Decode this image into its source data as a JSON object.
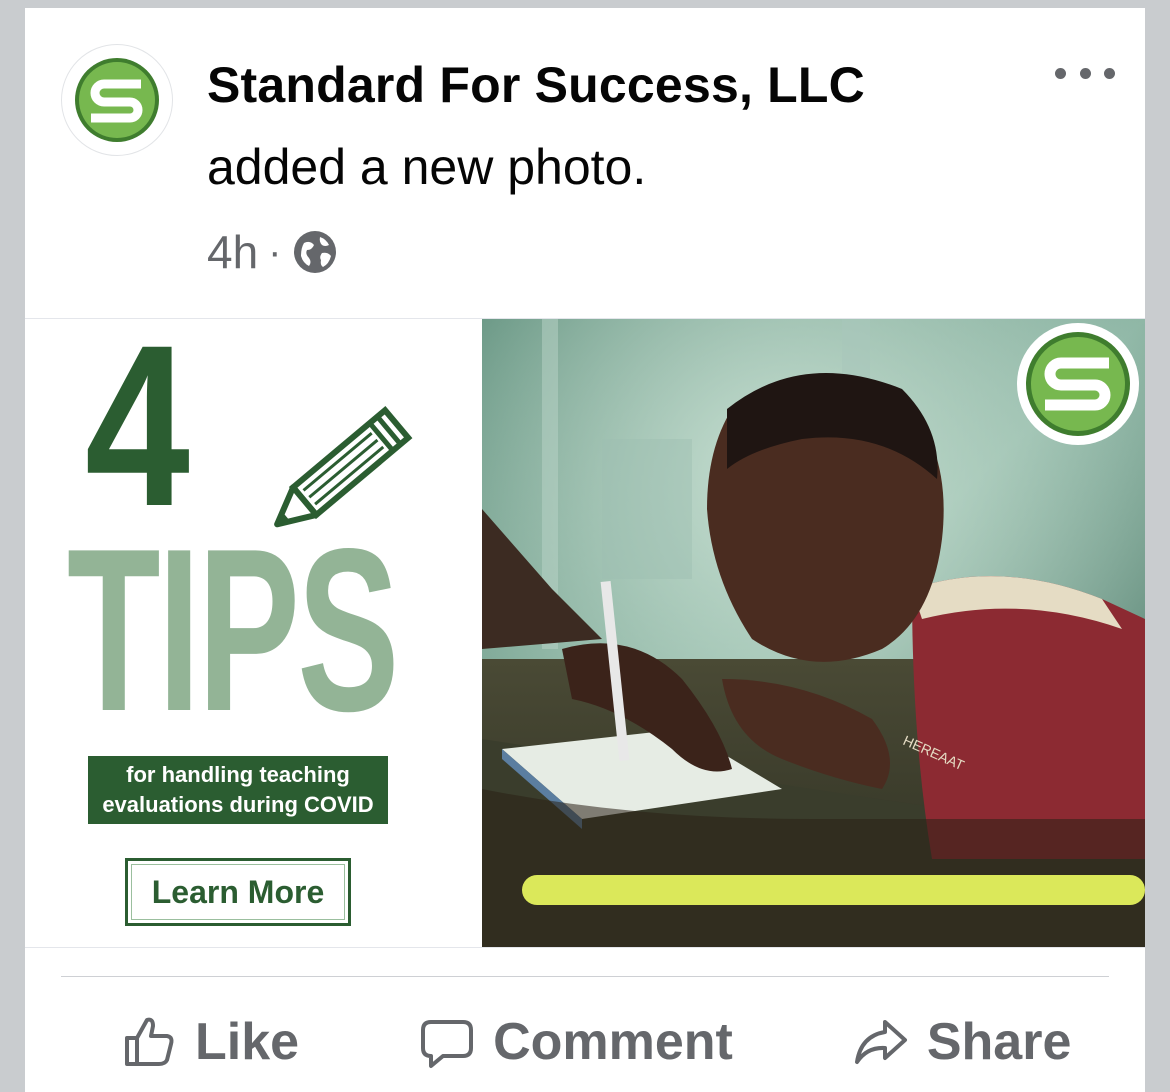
{
  "post": {
    "author": "Standard For Success, LLC",
    "action": "added a new photo.",
    "time": "4h",
    "separator": "·",
    "privacy_icon": "globe-icon",
    "menu_icon": "more-options-icon"
  },
  "photo": {
    "headline_number": "4",
    "headline_word": "TIPS",
    "banner_line1": "for handling teaching",
    "banner_line2": "evaluations during COVID",
    "cta_label": "Learn More",
    "brand_logo_letter": "S",
    "colors": {
      "dark_green": "#2b5d31",
      "light_green": "#93b496",
      "lime": "#dbe85a",
      "logo_green": "#6fb04a"
    }
  },
  "actions": {
    "like_label": "Like",
    "comment_label": "Comment",
    "share_label": "Share"
  },
  "colors": {
    "text_primary": "#050505",
    "text_secondary": "#65676b",
    "page_background": "#c9cccf"
  }
}
